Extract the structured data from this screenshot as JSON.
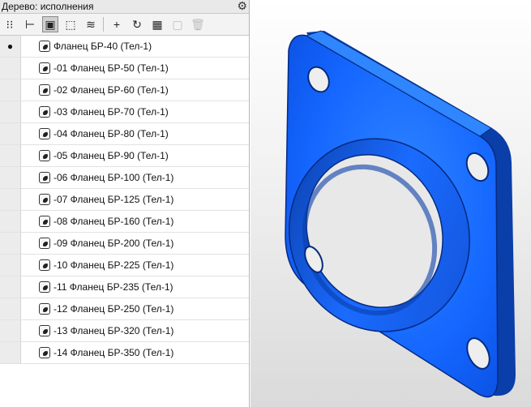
{
  "panel": {
    "title": "Дерево: исполнения",
    "toolbar": [
      {
        "name": "tree-structure-icon",
        "glyph": "⁝⁝",
        "active": false,
        "disabled": false
      },
      {
        "name": "tree-hierarchy-icon",
        "glyph": "⊢",
        "active": false,
        "disabled": false
      },
      {
        "name": "variants-icon",
        "glyph": "▣",
        "active": true,
        "disabled": false
      },
      {
        "name": "select-frame-icon",
        "glyph": "⬚",
        "active": false,
        "disabled": false
      },
      {
        "name": "layers-icon",
        "glyph": "≋",
        "active": false,
        "disabled": false
      },
      {
        "name": "add-icon",
        "glyph": "+",
        "active": false,
        "disabled": false
      },
      {
        "name": "refresh-icon",
        "glyph": "↻",
        "active": false,
        "disabled": false
      },
      {
        "name": "table-icon",
        "glyph": "▦",
        "active": false,
        "disabled": false
      },
      {
        "name": "save-icon",
        "glyph": "▢",
        "active": false,
        "disabled": true
      },
      {
        "name": "delete-icon",
        "glyph": "🗑",
        "active": false,
        "disabled": true
      }
    ],
    "rows": [
      {
        "label": "Фланец БР-40 (Тел-1)",
        "current": true
      },
      {
        "label": "-01 Фланец БР-50 (Тел-1)",
        "current": false
      },
      {
        "label": "-02 Фланец БР-60 (Тел-1)",
        "current": false
      },
      {
        "label": "-03 Фланец БР-70 (Тел-1)",
        "current": false
      },
      {
        "label": "-04 Фланец БР-80 (Тел-1)",
        "current": false
      },
      {
        "label": "-05 Фланец БР-90 (Тел-1)",
        "current": false
      },
      {
        "label": "-06 Фланец БР-100 (Тел-1)",
        "current": false
      },
      {
        "label": "-07 Фланец БР-125 (Тел-1)",
        "current": false
      },
      {
        "label": "-08 Фланец БР-160 (Тел-1)",
        "current": false
      },
      {
        "label": "-09 Фланец БР-200 (Тел-1)",
        "current": false
      },
      {
        "label": "-10 Фланец БР-225 (Тел-1)",
        "current": false
      },
      {
        "label": "-11 Фланец БР-235 (Тел-1)",
        "current": false
      },
      {
        "label": "-12 Фланец БР-250 (Тел-1)",
        "current": false
      },
      {
        "label": "-13 Фланец БР-320 (Тел-1)",
        "current": false
      },
      {
        "label": "-14 Фланец БР-350 (Тел-1)",
        "current": false
      }
    ],
    "current_marker": "●"
  },
  "colors": {
    "model_blue": "#1466ff",
    "model_dark": "#0a3ea8",
    "model_light": "#2f86ff"
  }
}
